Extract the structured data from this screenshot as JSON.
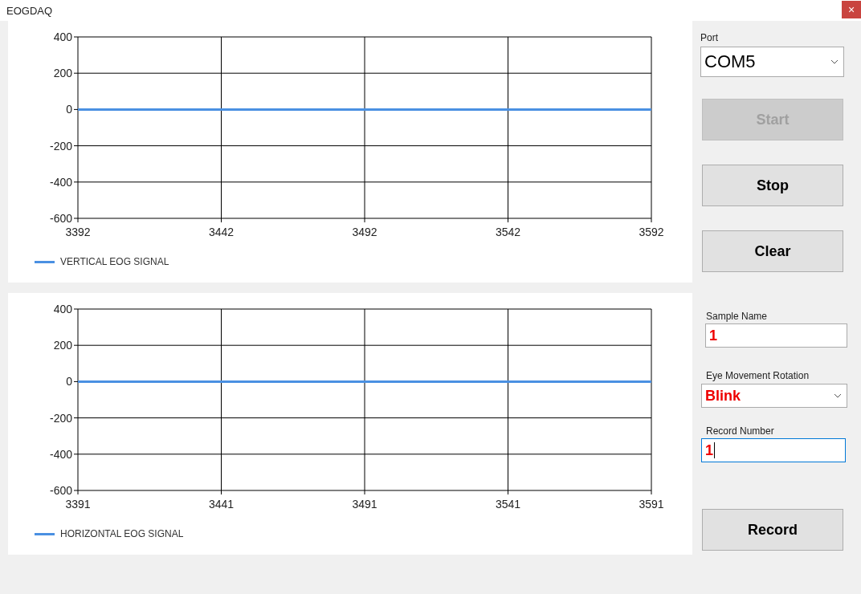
{
  "window": {
    "title": "EOGDAQ",
    "close": "×"
  },
  "charts": [
    {
      "chart_data": {
        "type": "line",
        "grid": true,
        "x": [
          3392,
          3442,
          3492,
          3542,
          3592
        ],
        "xlim": [
          3392,
          3592
        ],
        "ylim": [
          -600,
          400
        ],
        "xticks": [
          3392,
          3442,
          3492,
          3542,
          3592
        ],
        "yticks": [
          -600,
          -400,
          -200,
          0,
          200,
          400
        ],
        "series": [
          {
            "name": "VERTICAL EOG SIGNAL",
            "color": "#4a90e2",
            "values": [
              0,
              0,
              0,
              0,
              0
            ]
          }
        ]
      }
    },
    {
      "chart_data": {
        "type": "line",
        "grid": true,
        "x": [
          3391,
          3441,
          3491,
          3541,
          3591
        ],
        "xlim": [
          3391,
          3591
        ],
        "ylim": [
          -600,
          400
        ],
        "xticks": [
          3391,
          3441,
          3491,
          3541,
          3591
        ],
        "yticks": [
          -600,
          -400,
          -200,
          0,
          200,
          400
        ],
        "series": [
          {
            "name": "HORIZONTAL EOG SIGNAL",
            "color": "#4a90e2",
            "values": [
              0,
              0,
              0,
              0,
              0
            ]
          }
        ]
      }
    }
  ],
  "port": {
    "label": "Port",
    "value": "COM5"
  },
  "buttons": [
    {
      "label": "Start",
      "disabled": true
    },
    {
      "label": "Stop",
      "disabled": false
    },
    {
      "label": "Clear",
      "disabled": false
    }
  ],
  "sample_name": {
    "label": "Sample Name",
    "value": "1"
  },
  "eye_movement_rotation": {
    "label": "Eye Movement Rotation",
    "value": "Blink"
  },
  "record_number": {
    "label": "Record Number",
    "value": "1",
    "focused": true
  },
  "record_button": {
    "label": "Record",
    "disabled": false
  }
}
